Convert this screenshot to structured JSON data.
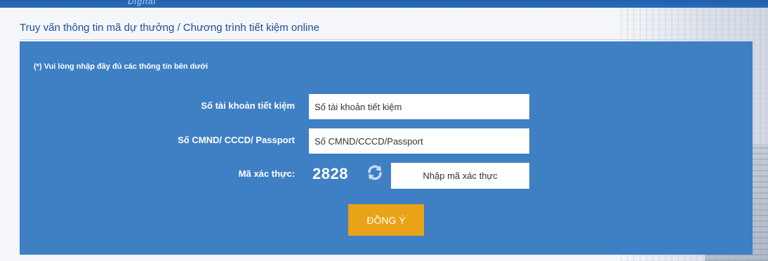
{
  "header": {
    "brand_fragment": "Digital",
    "title": "Truy vấn thông tin mã dự thưởng / Chương trình tiết kiệm online"
  },
  "form": {
    "note": "(*) Vui lòng nhập đầy đủ các thông tin bên dưới",
    "account": {
      "label": "Số tài khoản tiết kiệm",
      "placeholder": "Số tài khoản tiết kiệm",
      "value": ""
    },
    "id": {
      "label": "Số CMND/ CCCD/ Passport",
      "placeholder": "Số CMND/CCCD/Passport",
      "value": ""
    },
    "captcha": {
      "label": "Mã xác thực:",
      "code": "2828",
      "placeholder": "Nhập mã xác thực",
      "value": ""
    },
    "submit_label": "ĐỒNG Ý"
  },
  "icons": {
    "refresh": "refresh-icon"
  },
  "colors": {
    "panel": "#3f7fc4",
    "title": "#1c4f98",
    "submit": "#e8a317",
    "top_strip": "#1f5fae"
  }
}
